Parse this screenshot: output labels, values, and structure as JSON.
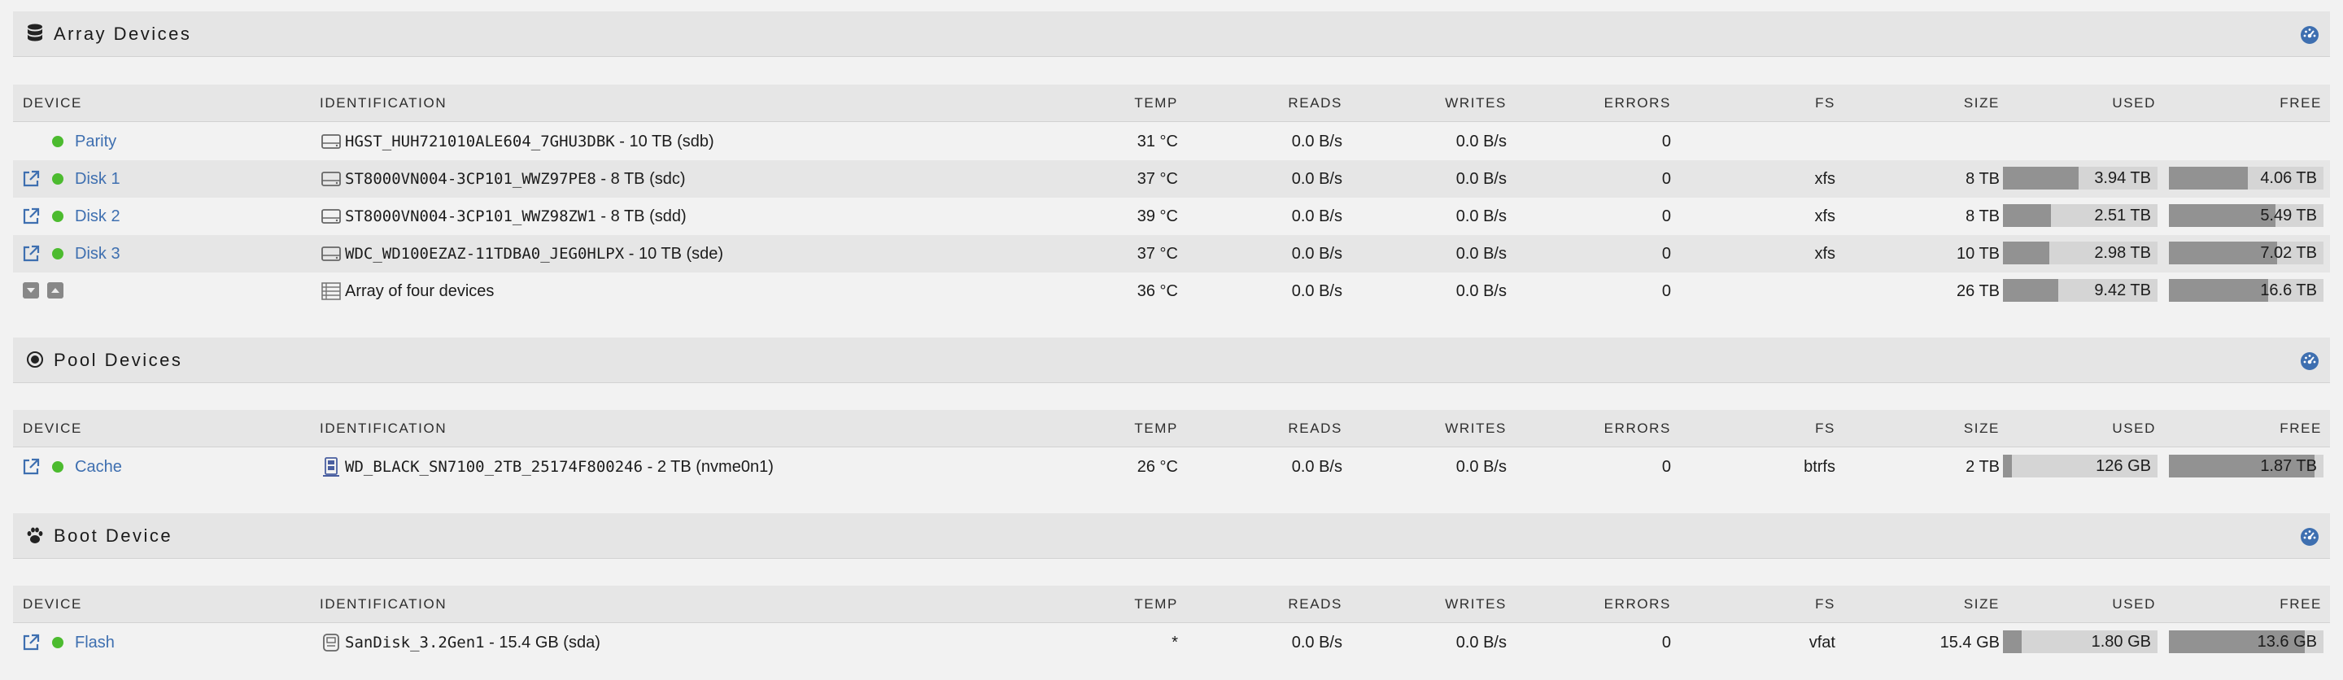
{
  "sections": {
    "array": {
      "title": "Array Devices",
      "headers": [
        "DEVICE",
        "IDENTIFICATION",
        "TEMP",
        "READS",
        "WRITES",
        "ERRORS",
        "FS",
        "SIZE",
        "USED",
        "FREE"
      ],
      "rows": [
        {
          "name": "Parity",
          "id": "HGST_HUH721010ALE604_7GHU3DBK",
          "id_suffix": " - 10 TB (sdb)",
          "temp": "31 °C",
          "reads": "0.0 B/s",
          "writes": "0.0 B/s",
          "errors": "0",
          "fs": "",
          "size": "",
          "used": "",
          "free": "",
          "used_frac": null,
          "free_frac": null
        },
        {
          "name": "Disk 1",
          "id": "ST8000VN004-3CP101_WWZ97PE8",
          "id_suffix": " - 8 TB (sdc)",
          "temp": "37 °C",
          "reads": "0.0 B/s",
          "writes": "0.0 B/s",
          "errors": "0",
          "fs": "xfs",
          "size": "8 TB",
          "used": "3.94 TB",
          "free": "4.06 TB",
          "used_frac": 0.49,
          "free_frac": 0.51
        },
        {
          "name": "Disk 2",
          "id": "ST8000VN004-3CP101_WWZ98ZW1",
          "id_suffix": " - 8 TB (sdd)",
          "temp": "39 °C",
          "reads": "0.0 B/s",
          "writes": "0.0 B/s",
          "errors": "0",
          "fs": "xfs",
          "size": "8 TB",
          "used": "2.51 TB",
          "free": "5.49 TB",
          "used_frac": 0.31,
          "free_frac": 0.69
        },
        {
          "name": "Disk 3",
          "id": "WDC_WD100EZAZ-11TDBA0_JEG0HLPX",
          "id_suffix": " - 10 TB (sde)",
          "temp": "37 °C",
          "reads": "0.0 B/s",
          "writes": "0.0 B/s",
          "errors": "0",
          "fs": "xfs",
          "size": "10 TB",
          "used": "2.98 TB",
          "free": "7.02 TB",
          "used_frac": 0.3,
          "free_frac": 0.7
        }
      ],
      "summary": {
        "id": "Array of four devices",
        "temp": "36 °C",
        "reads": "0.0 B/s",
        "writes": "0.0 B/s",
        "errors": "0",
        "size": "26 TB",
        "used": "9.42 TB",
        "free": "16.6 TB",
        "used_frac": 0.36,
        "free_frac": 0.64
      }
    },
    "pool": {
      "title": "Pool Devices",
      "headers": [
        "DEVICE",
        "IDENTIFICATION",
        "TEMP",
        "READS",
        "WRITES",
        "ERRORS",
        "FS",
        "SIZE",
        "USED",
        "FREE"
      ],
      "rows": [
        {
          "name": "Cache",
          "id": "WD_BLACK_SN7100_2TB_25174F800246",
          "id_suffix": " - 2 TB (nvme0n1)",
          "temp": "26 °C",
          "reads": "0.0 B/s",
          "writes": "0.0 B/s",
          "errors": "0",
          "fs": "btrfs",
          "size": "2 TB",
          "used": "126 GB",
          "free": "1.87 TB",
          "used_frac": 0.06,
          "free_frac": 0.94
        }
      ]
    },
    "boot": {
      "title": "Boot Device",
      "headers": [
        "DEVICE",
        "IDENTIFICATION",
        "TEMP",
        "READS",
        "WRITES",
        "ERRORS",
        "FS",
        "SIZE",
        "USED",
        "FREE"
      ],
      "rows": [
        {
          "name": "Flash",
          "id": "SanDisk_3.2Gen1",
          "id_suffix": " - 15.4 GB (sda)",
          "temp": "*",
          "reads": "0.0 B/s",
          "writes": "0.0 B/s",
          "errors": "0",
          "fs": "vfat",
          "size": "15.4 GB",
          "used": "1.80 GB",
          "free": "13.6 GB",
          "used_frac": 0.12,
          "free_frac": 0.88
        }
      ]
    }
  },
  "colors": {
    "accent": "#3e6fb0",
    "status_ok": "#4cbb2f",
    "bar_fill": "#929292",
    "bar_bg": "#d5d5d5"
  },
  "icons": {
    "array": "database-icon",
    "pool": "target-icon",
    "boot": "paw-icon",
    "dashboard": "dashboard-icon"
  }
}
